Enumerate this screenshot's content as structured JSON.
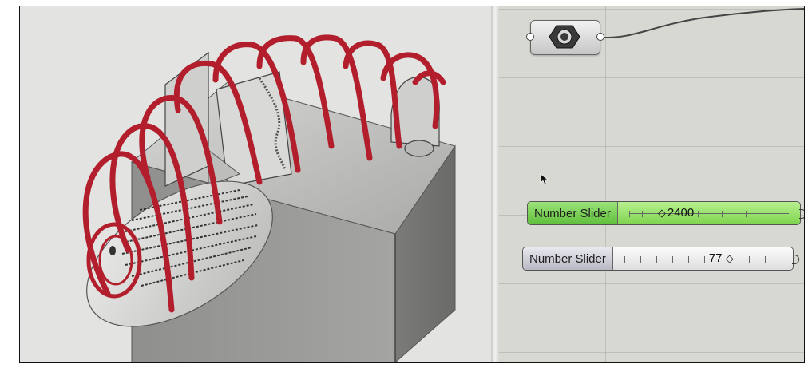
{
  "viewport": {
    "model_color": "#9a9a98",
    "rib_color": "#b21e2c"
  },
  "canvas": {
    "grid_color": "#aaaaA5",
    "param_icon": "gear-icon",
    "sliders": [
      {
        "label": "Number Slider",
        "value": "2400",
        "style": "green",
        "position": 0.12
      },
      {
        "label": "Number Slider",
        "value": "77",
        "style": "grey",
        "position": 0.88
      }
    ],
    "cursor_icon": "mouse-pointer-icon"
  }
}
